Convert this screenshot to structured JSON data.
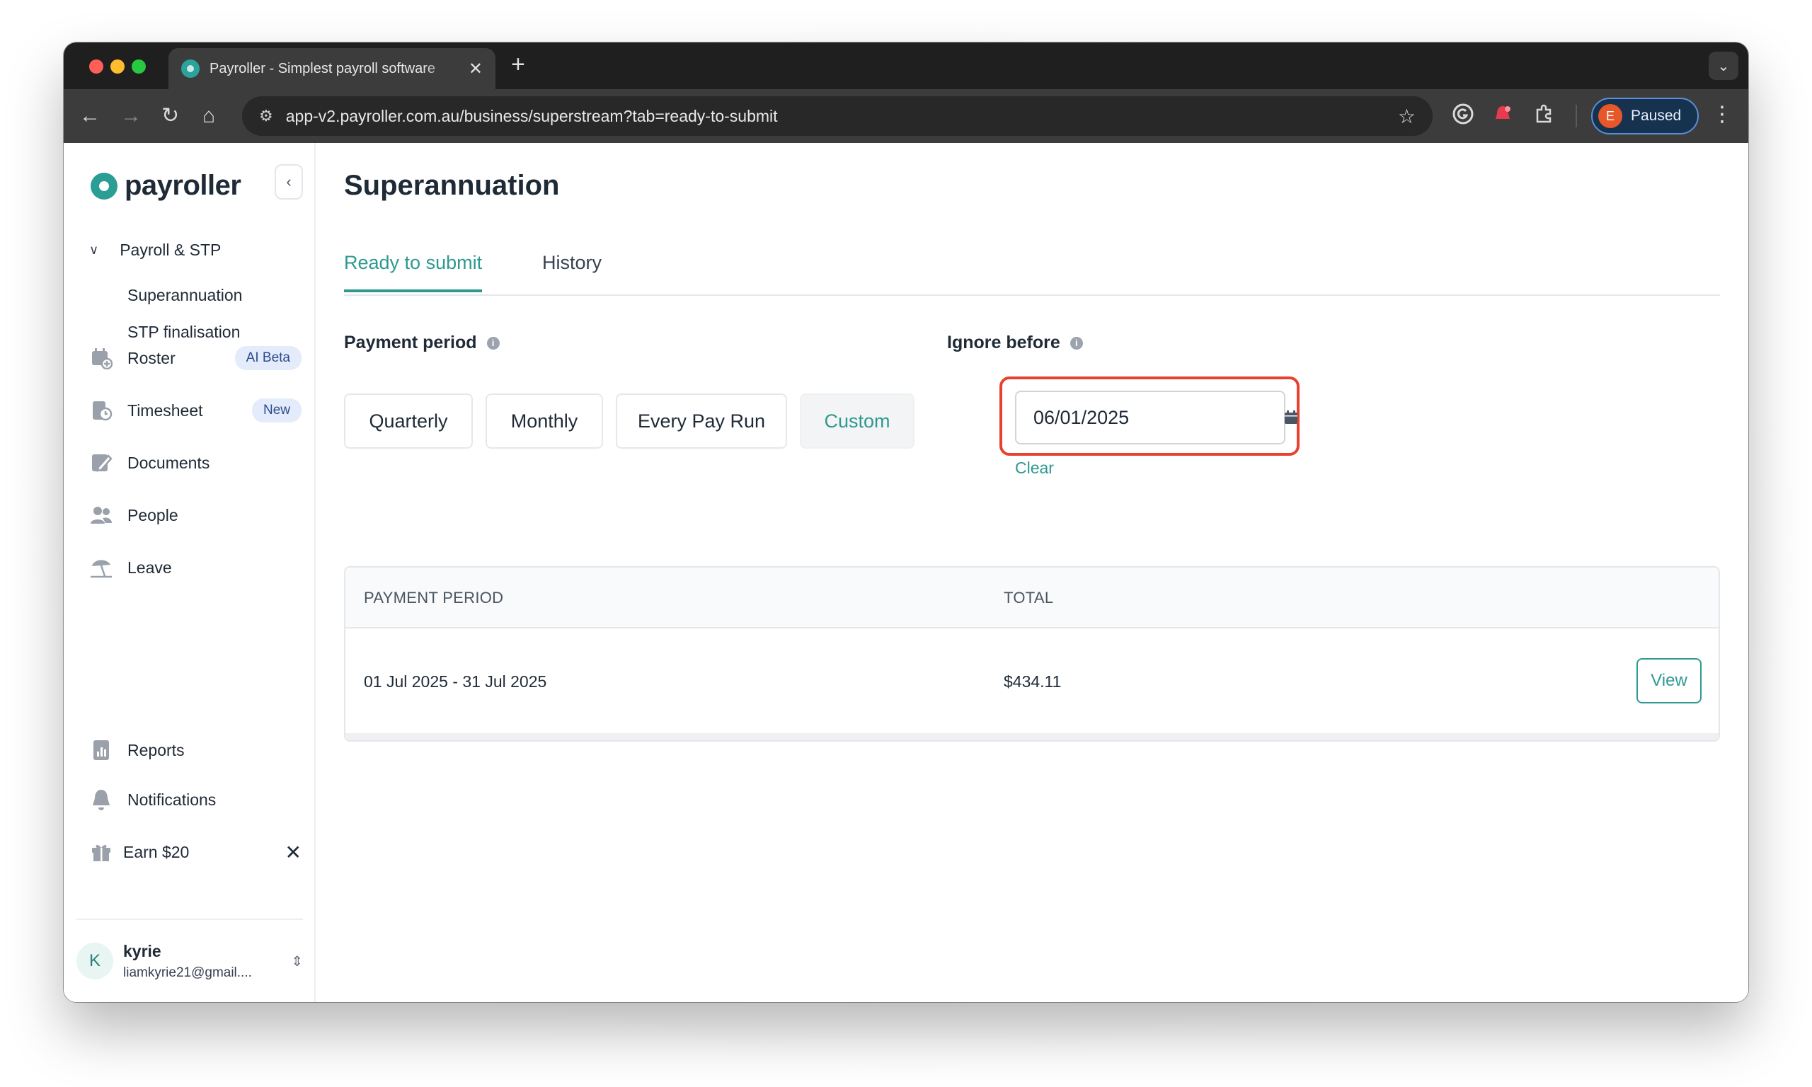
{
  "browser": {
    "tab_title": "Payroller - Simplest payroll software",
    "new_tab_symbol": "+",
    "url": "app-v2.payroller.com.au/business/superstream?tab=ready-to-submit",
    "profile_initial": "E",
    "profile_status": "Paused"
  },
  "sidebar": {
    "brand": "payroller",
    "group": "Payroll & STP",
    "sub_items": [
      "Superannuation",
      "STP finalisation"
    ],
    "items": [
      {
        "label": "Roster",
        "badge": "AI Beta",
        "icon": "roster-icon"
      },
      {
        "label": "Timesheet",
        "badge": "New",
        "icon": "timesheet-icon"
      },
      {
        "label": "Documents",
        "icon": "documents-icon"
      },
      {
        "label": "People",
        "icon": "people-icon"
      },
      {
        "label": "Leave",
        "icon": "leave-icon"
      }
    ],
    "bottom_items": [
      {
        "label": "Reports",
        "icon": "reports-icon"
      },
      {
        "label": "Notifications",
        "icon": "bell-icon"
      },
      {
        "label": "Earn $20",
        "icon": "gift-icon"
      }
    ],
    "user": {
      "initial": "K",
      "name": "kyrie",
      "email": "liamkyrie21@gmail...."
    }
  },
  "main": {
    "title": "Superannuation",
    "tabs": [
      {
        "label": "Ready to submit",
        "active": true
      },
      {
        "label": "History",
        "active": false
      }
    ],
    "payment_period": {
      "label": "Payment period",
      "options": [
        "Quarterly",
        "Monthly",
        "Every Pay Run",
        "Custom"
      ],
      "selected": "Custom"
    },
    "ignore_before": {
      "label": "Ignore before",
      "value": "06/01/2025",
      "clear_label": "Clear"
    },
    "table": {
      "columns": [
        "PAYMENT PERIOD",
        "TOTAL"
      ],
      "rows": [
        {
          "period": "01 Jul 2025 - 31 Jul 2025",
          "total": "$434.11",
          "action": "View"
        }
      ]
    }
  },
  "colors": {
    "accent": "#2e9990",
    "highlight": "#e8422f",
    "badge_bg": "#e4ecfb"
  }
}
